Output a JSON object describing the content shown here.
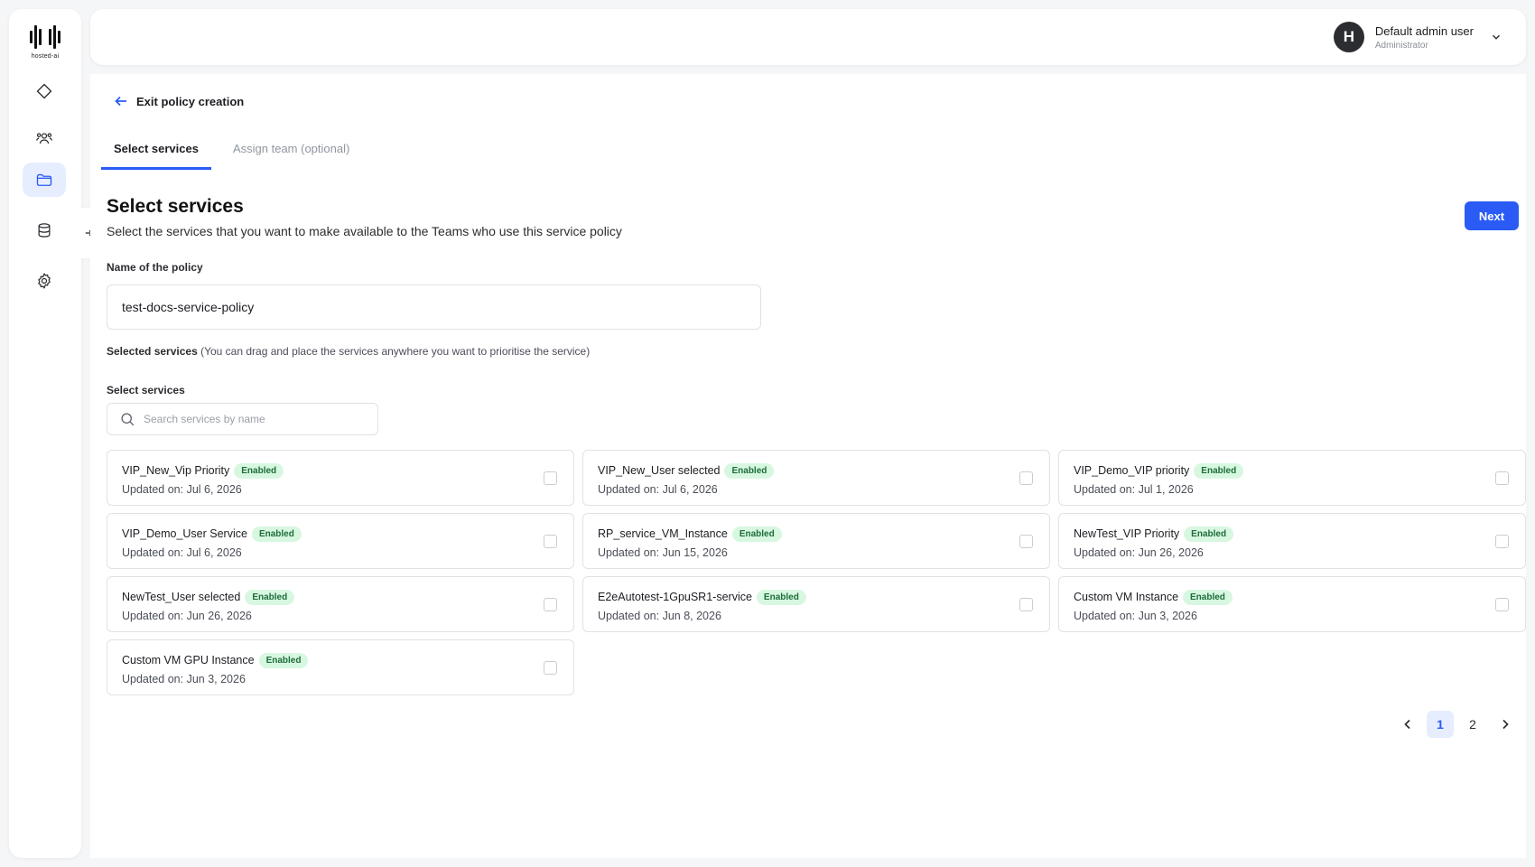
{
  "sidebar": {
    "logo_text": "hosted-ai",
    "items": [
      {
        "name": "services-nav",
        "icon": "diamond-icon",
        "active": false
      },
      {
        "name": "teams-nav",
        "icon": "team-icon",
        "active": false
      },
      {
        "name": "policies-nav",
        "icon": "folder-icon",
        "active": true
      },
      {
        "name": "storage-nav",
        "icon": "database-icon",
        "active": false
      },
      {
        "name": "settings-nav",
        "icon": "gear-icon",
        "active": false
      }
    ],
    "collapse_icon": "collapse-sidebar-icon"
  },
  "header": {
    "avatar_initial": "H",
    "user_name": "Default admin user",
    "user_role": "Administrator",
    "menu_icon": "chevron-down-icon"
  },
  "main": {
    "exit_link": "Exit policy creation",
    "tabs": [
      {
        "label": "Select services",
        "active": true
      },
      {
        "label": "Assign team (optional)",
        "active": false
      }
    ],
    "title": "Select services",
    "subtitle": "Select the services that you want to make available to the Teams who use this service policy",
    "next_button": "Next",
    "policy_name_label": "Name of the policy",
    "policy_name_value": "test-docs-service-policy",
    "selected_label": "Selected services",
    "selected_hint": "(You can drag and place the services anywhere you want to prioritise the service)",
    "select_label": "Select services",
    "search_placeholder": "Search services by name",
    "services": [
      {
        "name": "VIP_New_Vip Priority",
        "status": "Enabled",
        "updated": "Updated on: Jul 6, 2026",
        "checked": false
      },
      {
        "name": "VIP_New_User selected",
        "status": "Enabled",
        "updated": "Updated on: Jul 6, 2026",
        "checked": false
      },
      {
        "name": "VIP_Demo_VIP priority",
        "status": "Enabled",
        "updated": "Updated on: Jul 1, 2026",
        "checked": false
      },
      {
        "name": "VIP_Demo_User Service",
        "status": "Enabled",
        "updated": "Updated on: Jul 6, 2026",
        "checked": false
      },
      {
        "name": "RP_service_VM_Instance",
        "status": "Enabled",
        "updated": "Updated on: Jun 15, 2026",
        "checked": false
      },
      {
        "name": "NewTest_VIP Priority",
        "status": "Enabled",
        "updated": "Updated on: Jun 26, 2026",
        "checked": false
      },
      {
        "name": "NewTest_User selected",
        "status": "Enabled",
        "updated": "Updated on: Jun 26, 2026",
        "checked": false
      },
      {
        "name": "E2eAutotest-1GpuSR1-service",
        "status": "Enabled",
        "updated": "Updated on: Jun 8, 2026",
        "checked": false
      },
      {
        "name": "Custom VM Instance",
        "status": "Enabled",
        "updated": "Updated on: Jun 3, 2026",
        "checked": false
      },
      {
        "name": "Custom VM GPU Instance",
        "status": "Enabled",
        "updated": "Updated on: Jun 3, 2026",
        "checked": false
      }
    ],
    "pagination": {
      "pages": [
        "1",
        "2"
      ],
      "current": "1",
      "prev_icon": "chevron-left-icon",
      "next_icon": "chevron-right-icon"
    }
  },
  "colors": {
    "accent": "#2a5bf5",
    "active_nav_bg": "#e6edff",
    "badge_bg": "#d8f7e1",
    "badge_text": "#1d6d3a"
  }
}
